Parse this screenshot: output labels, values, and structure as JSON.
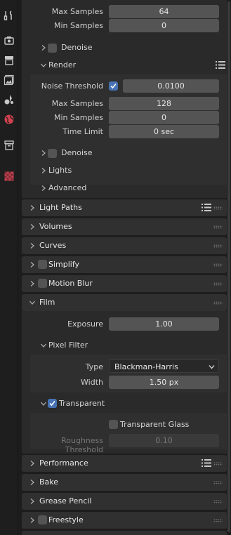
{
  "sidebar": {
    "icons": [
      "tool-icon",
      "render-icon",
      "output-icon",
      "view-layer-icon",
      "scene-icon",
      "world-icon",
      "collection-icon",
      "texture-icon"
    ]
  },
  "top": {
    "max_samples_label": "Max Samples",
    "max_samples_value": "64",
    "min_samples_label": "Min Samples",
    "min_samples_value": "0",
    "denoise_label": "Denoise"
  },
  "render": {
    "title": "Render",
    "noise_threshold_label": "Noise Threshold",
    "noise_threshold_checked": true,
    "noise_threshold_value": "0.0100",
    "max_samples_label": "Max Samples",
    "max_samples_value": "128",
    "min_samples_label": "Min Samples",
    "min_samples_value": "0",
    "time_limit_label": "Time Limit",
    "time_limit_value": "0 sec",
    "denoise_label": "Denoise",
    "lights_label": "Lights",
    "advanced_label": "Advanced"
  },
  "panels": {
    "light_paths": "Light Paths",
    "volumes": "Volumes",
    "curves": "Curves",
    "simplify": "Simplify",
    "motion_blur": "Motion Blur",
    "film": "Film",
    "performance": "Performance",
    "bake": "Bake",
    "grease_pencil": "Grease Pencil",
    "freestyle": "Freestyle"
  },
  "film": {
    "exposure_label": "Exposure",
    "exposure_value": "1.00",
    "pixel_filter_label": "Pixel Filter",
    "type_label": "Type",
    "type_value": "Blackman-Harris",
    "width_label": "Width",
    "width_value": "1.50 px",
    "transparent_label": "Transparent",
    "transparent_checked": true,
    "transparent_glass_label": "Transparent Glass",
    "transparent_glass_checked": false,
    "roughness_threshold_label": "Roughness Threshold",
    "roughness_threshold_value": "0.10"
  },
  "colors": {
    "accent": "#4772b3",
    "world_icon": "#d0424e",
    "texture_icon": "#c0404f"
  }
}
